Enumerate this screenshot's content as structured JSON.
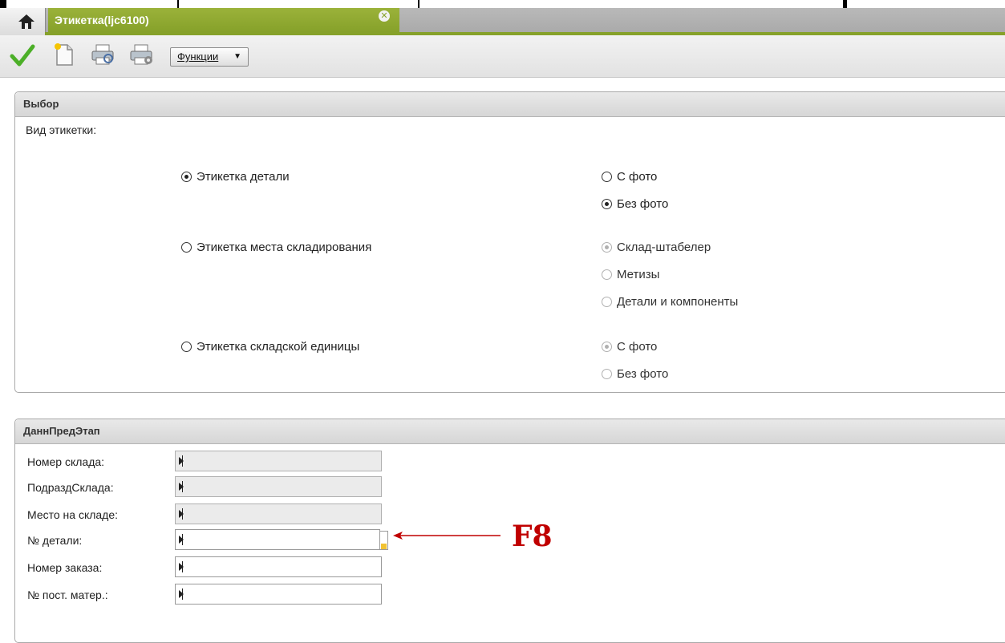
{
  "tab": {
    "title": "Этикетка(ljc6100)"
  },
  "toolbar": {
    "functions_label": "Функции"
  },
  "selection": {
    "heading": "Выбор",
    "label_type": "Вид этикетки:",
    "options": {
      "part_label": "Этикетка детали",
      "storage_place_label": "Этикетка места складирования",
      "storage_unit_label": "Этикетка складской единицы"
    },
    "part_photo": {
      "with_photo": "С фото",
      "without_photo": "Без фото"
    },
    "storage_place_types": {
      "stacker": "Склад-штабелер",
      "hardware": "Метизы",
      "parts_components": "Детали и компоненты"
    },
    "unit_photo": {
      "with_photo": "С фото",
      "without_photo": "Без фото"
    }
  },
  "prev_stage": {
    "heading": "ДаннПредЭтап",
    "fields": {
      "warehouse_number": {
        "label": "Номер склада:",
        "value": ""
      },
      "warehouse_subdivision": {
        "label": "ПодраздСклада:",
        "value": ""
      },
      "warehouse_place": {
        "label": "Место на складе:",
        "value": ""
      },
      "part_number": {
        "label": "№ детали:",
        "value": ""
      },
      "order_number": {
        "label": "Номер заказа:",
        "value": ""
      },
      "supplier_material_number": {
        "label": "№ пост. матер.:",
        "value": ""
      }
    }
  },
  "annotation": {
    "text": "F8",
    "color": "#c00000"
  },
  "colors": {
    "tab_green": "#86a12a",
    "tab_bar_gray": "#ababab"
  }
}
